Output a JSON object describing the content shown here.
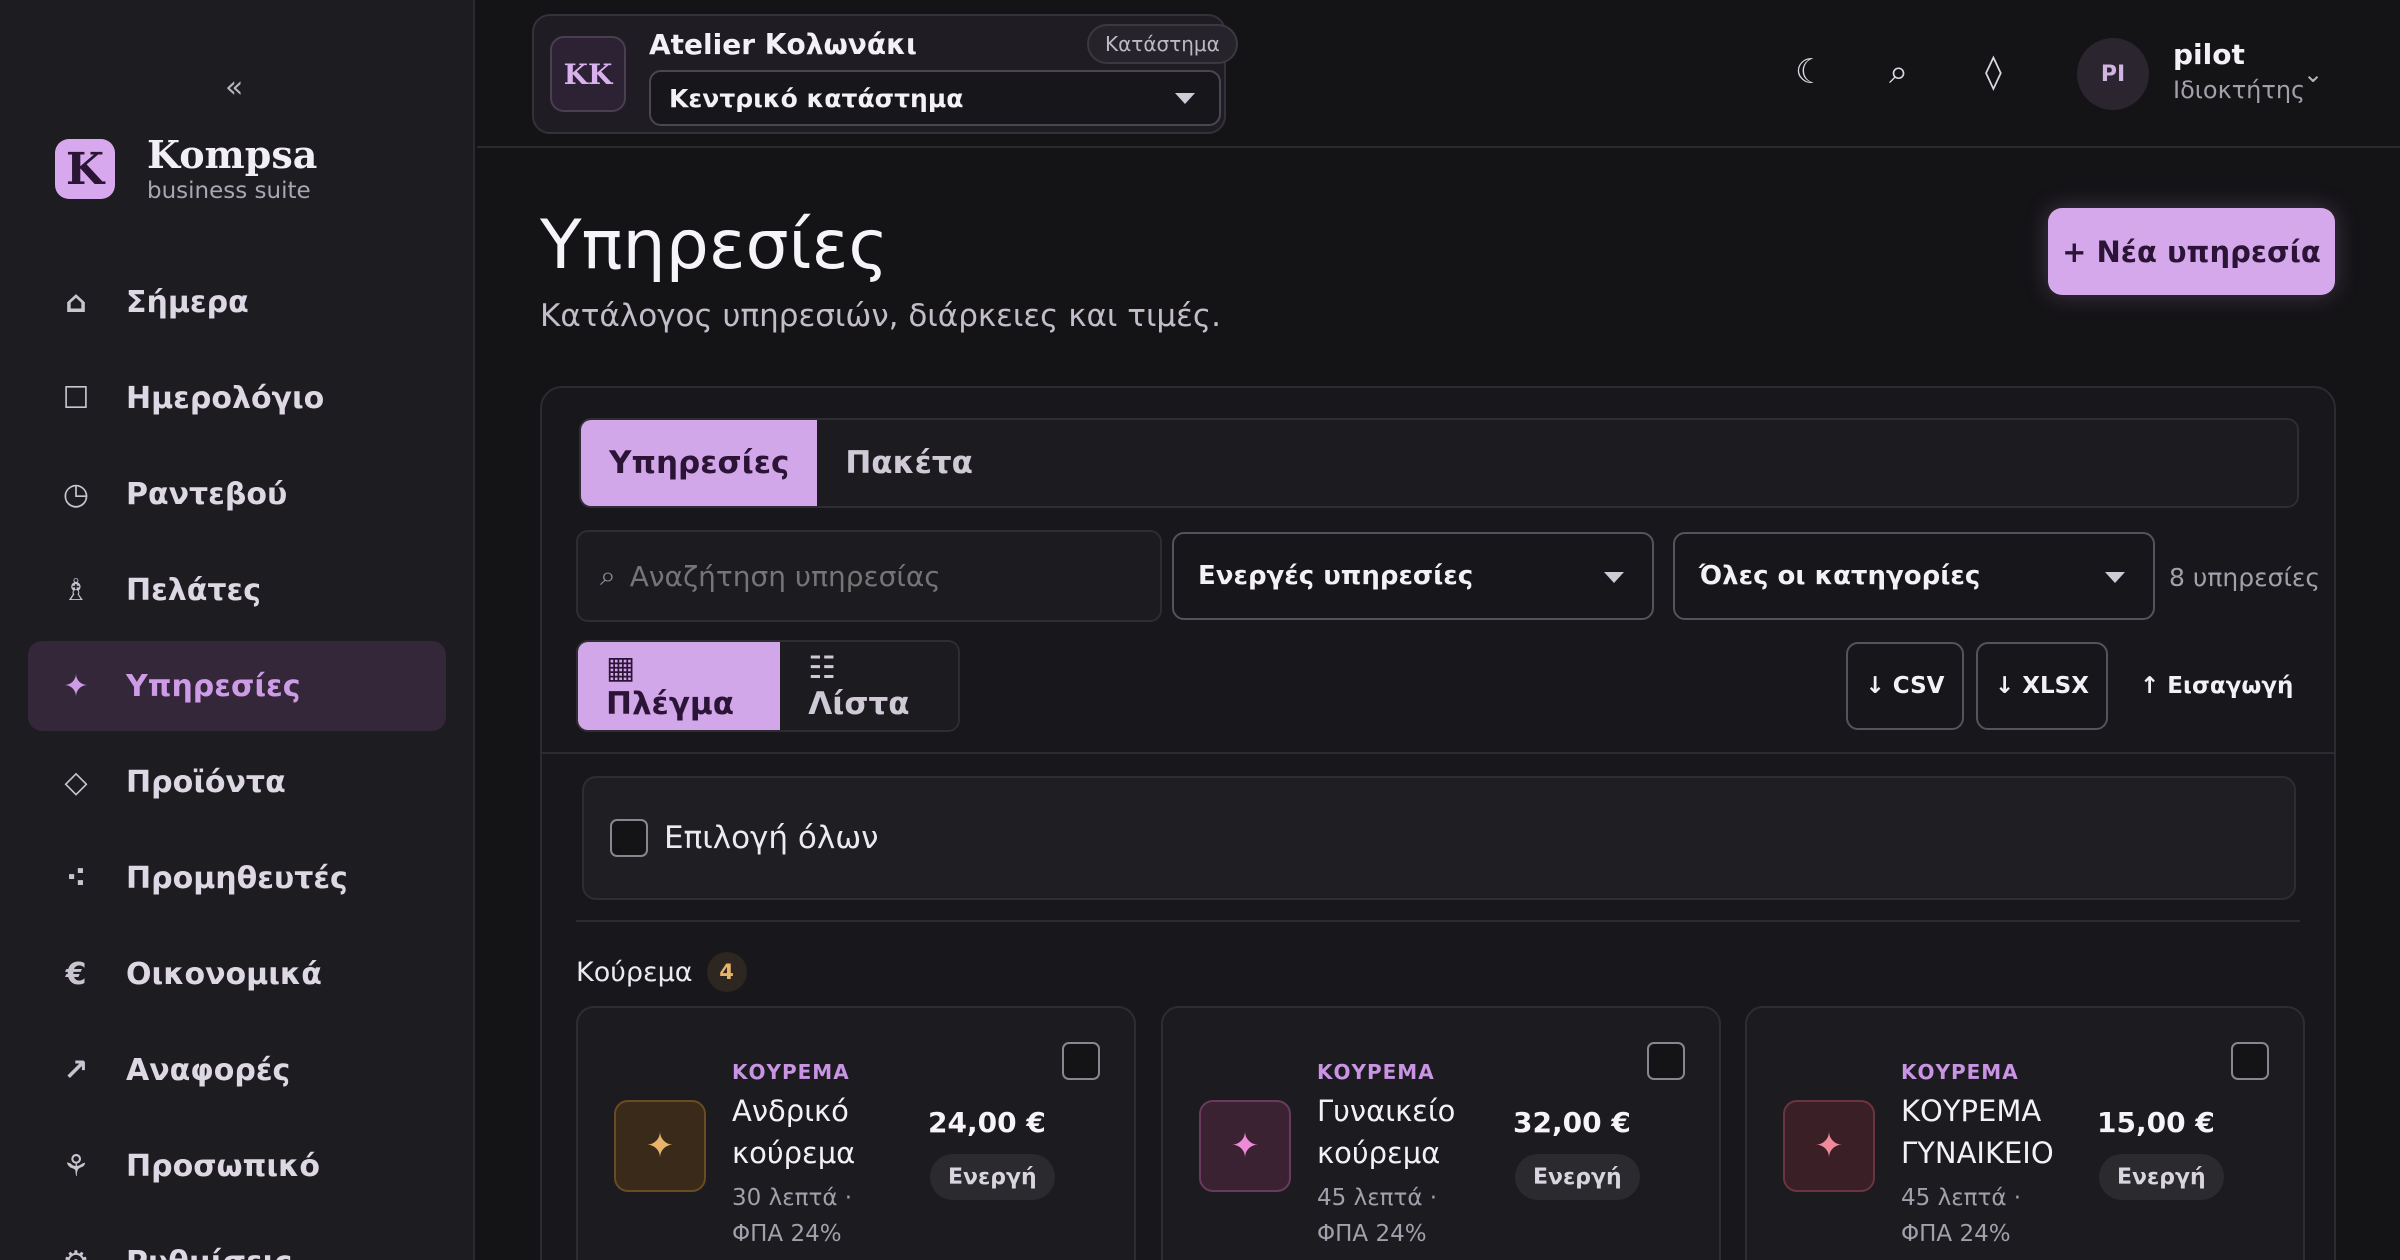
{
  "sidebar": {
    "collapse": "«",
    "brand": {
      "initial": "K",
      "name": "Kompsa",
      "subtitle": "business suite"
    },
    "items": [
      {
        "icon": "⌂",
        "label": "Σήμερα",
        "icon_name": "home-icon"
      },
      {
        "icon": "☐",
        "label": "Ημερολόγιο",
        "icon_name": "calendar-icon"
      },
      {
        "icon": "◷",
        "label": "Ραντεβού",
        "icon_name": "clock-icon"
      },
      {
        "icon": "♗",
        "label": "Πελάτες",
        "icon_name": "user-icon"
      },
      {
        "icon": "✦",
        "label": "Υπηρεσίες",
        "icon_name": "sparkle-icon",
        "active": true
      },
      {
        "icon": "◇",
        "label": "Προϊόντα",
        "icon_name": "diamond-icon"
      },
      {
        "icon": "⁖",
        "label": "Προμηθευτές",
        "icon_name": "dots-icon"
      },
      {
        "icon": "€",
        "label": "Οικονομικά",
        "icon_name": "euro-icon"
      },
      {
        "icon": "↗",
        "label": "Αναφορές",
        "icon_name": "trend-icon"
      },
      {
        "icon": "⚘",
        "label": "Προσωπικό",
        "icon_name": "staff-icon"
      },
      {
        "icon": "⚙",
        "label": "Ρυθμίσεις",
        "icon_name": "settings-icon"
      }
    ]
  },
  "header": {
    "store": {
      "initials": "KK",
      "name": "Atelier Κολωνάκι",
      "pill": "Κατάστημα",
      "selected": "Κεντρικό κατάστημα"
    },
    "icons": {
      "moon": "☾",
      "search": "⌕",
      "diamond": "◊"
    },
    "user": {
      "initials": "PI",
      "name": "pilot",
      "role": "Ιδιοκτήτης",
      "chevron": "⌄"
    }
  },
  "page": {
    "title": "Υπηρεσίες",
    "subtitle": "Κατάλογος υπηρεσιών, διάρκειες και τιμές.",
    "new_button": "+ Νέα υπηρεσία"
  },
  "tabs": [
    {
      "label": "Υπηρεσίες",
      "active": true
    },
    {
      "label": "Πακέτα",
      "active": false
    }
  ],
  "filters": {
    "search_icon": "⌕",
    "search_placeholder": "Αναζήτηση υπηρεσίας",
    "status_select": "Ενεργές υπηρεσίες",
    "category_select": "Όλες οι κατηγορίες",
    "count": "8 υπηρεσίες"
  },
  "view": {
    "grid": "▦ Πλέγμα",
    "list": "☷ Λίστα"
  },
  "actions": {
    "csv": "↓ CSV",
    "xlsx": "↓ XLSX",
    "import": "↑ Εισαγωγή"
  },
  "select_all": "Επιλογή όλων",
  "category": {
    "title": "Κούρεμα",
    "count": "4"
  },
  "cards": [
    {
      "category": "ΚΟΥΡΕΜΑ",
      "name": "Ανδρικό κούρεμα",
      "meta": "30 λεπτά · ΦΠΑ 24%",
      "price": "24,00 €",
      "status": "Ενεργή",
      "icon": "✦",
      "icon_color": "#e9b36b",
      "icon_bg": "#3a2a1a",
      "icon_border": "#6b4b22"
    },
    {
      "category": "ΚΟΥΡΕΜΑ",
      "name": "Γυναικείο κούρεμα",
      "meta": "45 λεπτά · ΦΠΑ 24%",
      "price": "32,00 €",
      "status": "Ενεργή",
      "icon": "✦",
      "icon_color": "#ee8ad6",
      "icon_bg": "#3a2232",
      "icon_border": "#6a3a5c"
    },
    {
      "category": "ΚΟΥΡΕΜΑ",
      "name": "ΚΟΥΡΕΜΑ ΓΥΝΑΙΚΕΙΟ",
      "meta": "45 λεπτά · ΦΠΑ 24%",
      "price": "15,00 €",
      "status": "Ενεργή",
      "icon": "✦",
      "icon_color": "#f08a9a",
      "icon_bg": "#3a2026",
      "icon_border": "#6a3440"
    }
  ]
}
